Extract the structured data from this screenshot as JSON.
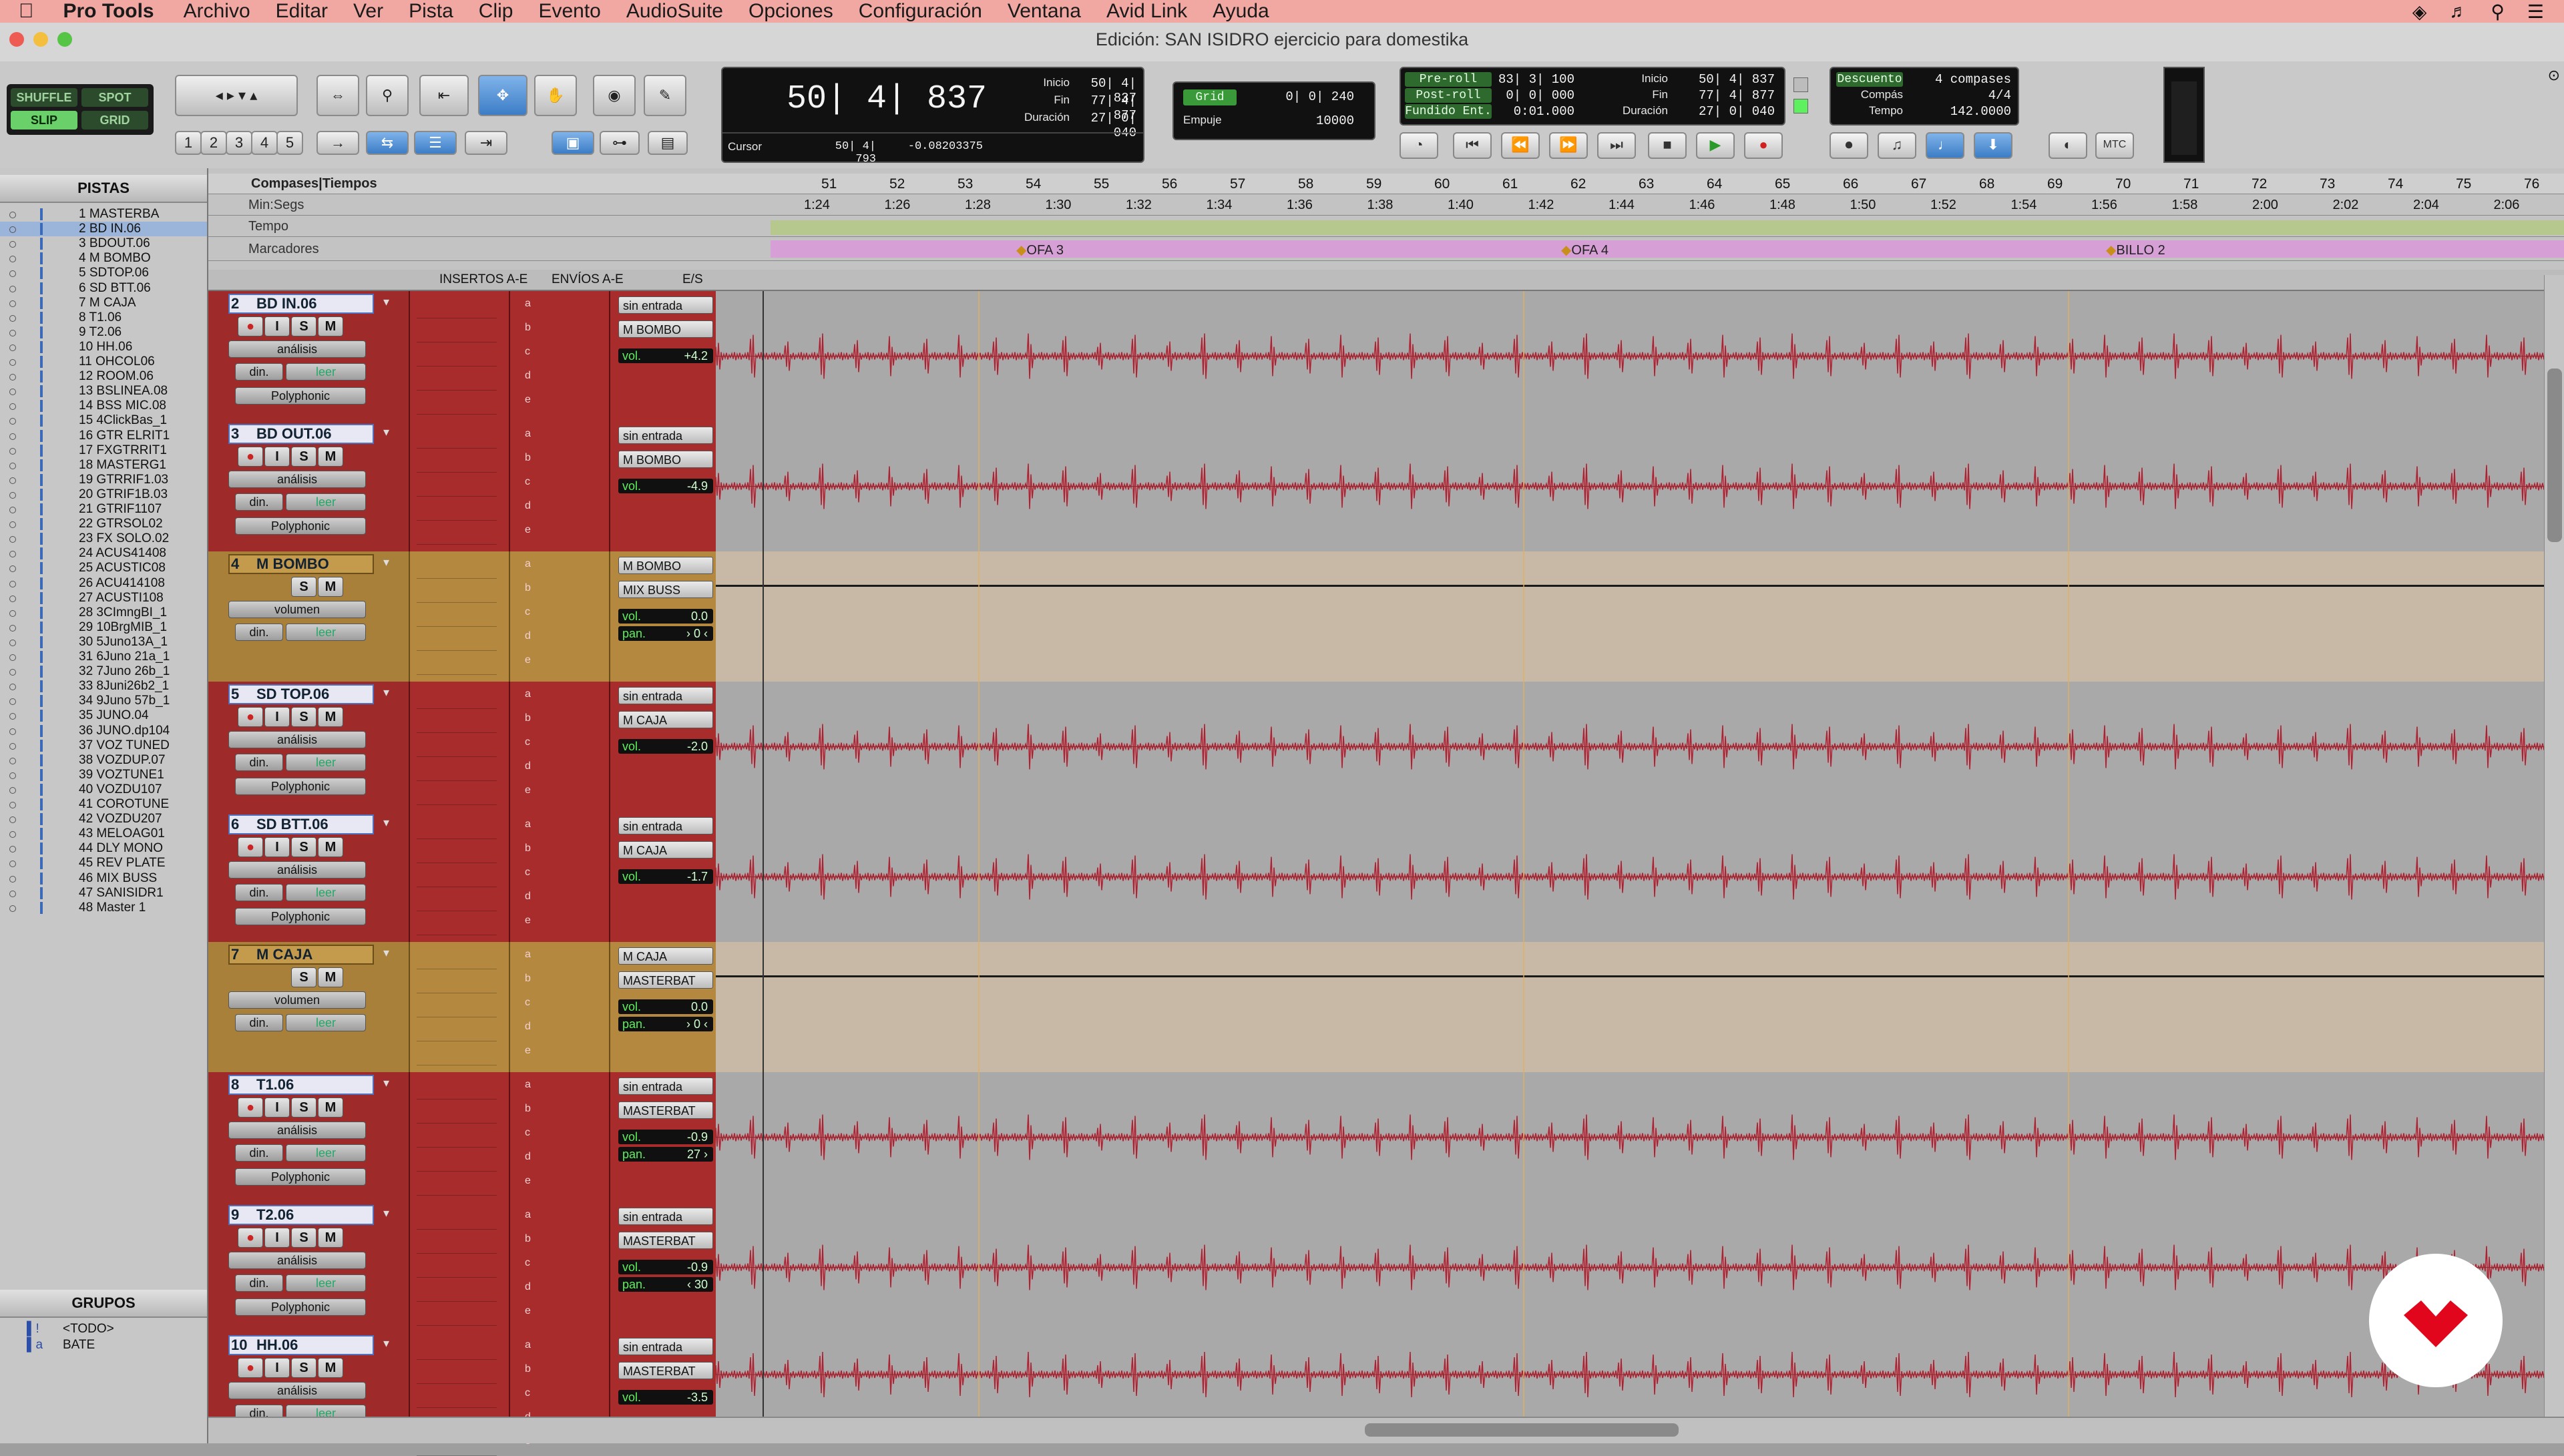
{
  "menubar": {
    "app": "Pro Tools",
    "items": [
      "Archivo",
      "Editar",
      "Ver",
      "Pista",
      "Clip",
      "Evento",
      "AudioSuite",
      "Opciones",
      "Configuración",
      "Ventana",
      "Avid Link",
      "Ayuda"
    ]
  },
  "window": {
    "title": "Edición: SAN ISIDRO ejercicio para domestika"
  },
  "modes": {
    "shuffle": "SHUFFLE",
    "spot": "SPOT",
    "slip": "SLIP",
    "grid": "GRID"
  },
  "zoom_presets": [
    "1",
    "2",
    "3",
    "4",
    "5"
  ],
  "counter": {
    "main": "50| 4| 837",
    "inicio_label": "Inicio",
    "fin_label": "Fin",
    "duracion_label": "Duración",
    "inicio": "50| 4| 837",
    "fin": "77| 4| 877",
    "duracion": "27| 0| 040",
    "cursor_label": "Cursor",
    "cursor": "50| 4| 793",
    "cursor_sample": "-0.08203375"
  },
  "grid": {
    "label": "Grid",
    "value": "0| 0| 240",
    "empuje_label": "Empuje",
    "empuje": "10000"
  },
  "prepost": {
    "preroll_label": "Pre-roll",
    "preroll": "83| 3| 100",
    "postroll_label": "Post-roll",
    "postroll": "0| 0| 000",
    "fundido_label": "Fundido Ent.",
    "fundido": "0:01.000",
    "inicio_label": "Inicio",
    "inicio": "50| 4| 837",
    "fin_label": "Fin",
    "fin": "77| 4| 877",
    "duracion_label": "Duración",
    "duracion": "27| 0| 040"
  },
  "meter": {
    "descuento_label": "Descuento",
    "descuento": "4 compases",
    "compas_label": "Compás",
    "compas": "4/4",
    "tempo_label": "Tempo",
    "tempo": "142.0000"
  },
  "mtc": "MTC",
  "pistas": {
    "header": "PISTAS",
    "items": [
      "1 MASTERBA",
      "2 BD IN.06",
      "3 BDOUT.06",
      "4 M BOMBO",
      "5 SDTOP.06",
      "6 SD BTT.06",
      "7 M CAJA",
      "8 T1.06",
      "9 T2.06",
      "10 HH.06",
      "11 OHCOL06",
      "12 ROOM.06",
      "13 BSLINEA.08",
      "14 BSS MIC.08",
      "15 4ClickBas_1",
      "16 GTR ELRIT1",
      "17 FXGTRRIT1",
      "18 MASTERG1",
      "19 GTRRIF1.03",
      "20 GTRIF1B.03",
      "21 GTRIF1107",
      "22 GTRSOL02",
      "23 FX SOLO.02",
      "24 ACUS41408",
      "25 ACUSTIC08",
      "26 ACU414108",
      "27 ACUSTI108",
      "28 3CImngBI_1",
      "29 10BrgMIB_1",
      "30 5Juno13A_1",
      "31 6Juno 21a_1",
      "32 7Juno 26b_1",
      "33 8Juni26b2_1",
      "34 9Juno 57b_1",
      "35 JUNO.04",
      "36 JUNO.dp104",
      "37 VOZ TUNED",
      "38 VOZDUP.07",
      "39 VOZTUNE1",
      "40 VOZDU107",
      "41 COROTUNE",
      "42 VOZDU207",
      "43 MELOAG01",
      "44 DLY MONO",
      "45 REV PLATE",
      "46 MIX BUSS",
      "47 SANISIDR1",
      "48 Master 1"
    ]
  },
  "grupos": {
    "header": "GRUPOS",
    "items": [
      "<TODO>",
      "BATE"
    ]
  },
  "rulers": {
    "compases": "Compases|Tiempos",
    "minsegs": "Min:Segs",
    "tempo": "Tempo",
    "marcadores": "Marcadores",
    "bars": [
      "51",
      "52",
      "53",
      "54",
      "55",
      "56",
      "57",
      "58",
      "59",
      "60",
      "61",
      "62",
      "63",
      "64",
      "65",
      "66",
      "67",
      "68",
      "69",
      "70",
      "71",
      "72",
      "73",
      "74",
      "75",
      "76"
    ],
    "times": [
      "1:24",
      "1:26",
      "1:28",
      "1:30",
      "1:32",
      "1:34",
      "1:36",
      "1:38",
      "1:40",
      "1:42",
      "1:44",
      "1:46",
      "1:48",
      "1:50",
      "1:52",
      "1:54",
      "1:56",
      "1:58",
      "2:00",
      "2:02",
      "2:04",
      "2:06"
    ],
    "markers": [
      "OFA 3",
      "OFA 4",
      "BILLO 2"
    ]
  },
  "columns": {
    "inserts": "INSERTOS A-E",
    "sends": "ENVÍOS A-E",
    "io": "E/S"
  },
  "tracks": [
    {
      "num": "2",
      "name": "BD IN.06",
      "aux": false,
      "mode": "análisis",
      "din": "din.",
      "leer": "leer",
      "poly": "Polyphonic",
      "input": "sin entrada",
      "output": "M BOMBO",
      "vol": "+4.2",
      "pan": ""
    },
    {
      "num": "3",
      "name": "BD OUT.06",
      "aux": false,
      "mode": "análisis",
      "din": "din.",
      "leer": "leer",
      "poly": "Polyphonic",
      "input": "sin entrada",
      "output": "M BOMBO",
      "vol": "-4.9",
      "pan": ""
    },
    {
      "num": "4",
      "name": "M BOMBO",
      "aux": true,
      "mode": "volumen",
      "din": "din.",
      "leer": "leer",
      "poly": "",
      "input": "M BOMBO",
      "output": "MIX BUSS",
      "vol": "0.0",
      "pan": "› 0 ‹"
    },
    {
      "num": "5",
      "name": "SD TOP.06",
      "aux": false,
      "mode": "análisis",
      "din": "din.",
      "leer": "leer",
      "poly": "Polyphonic",
      "input": "sin entrada",
      "output": "M CAJA",
      "vol": "-2.0",
      "pan": ""
    },
    {
      "num": "6",
      "name": "SD BTT.06",
      "aux": false,
      "mode": "análisis",
      "din": "din.",
      "leer": "leer",
      "poly": "Polyphonic",
      "input": "sin entrada",
      "output": "M CAJA",
      "vol": "-1.7",
      "pan": ""
    },
    {
      "num": "7",
      "name": "M CAJA",
      "aux": true,
      "mode": "volumen",
      "din": "din.",
      "leer": "leer",
      "poly": "",
      "input": "M CAJA",
      "output": "MASTERBAT",
      "vol": "0.0",
      "pan": "› 0 ‹"
    },
    {
      "num": "8",
      "name": "T1.06",
      "aux": false,
      "mode": "análisis",
      "din": "din.",
      "leer": "leer",
      "poly": "Polyphonic",
      "input": "sin entrada",
      "output": "MASTERBAT",
      "vol": "-0.9",
      "pan": "27 ›"
    },
    {
      "num": "9",
      "name": "T2.06",
      "aux": false,
      "mode": "análisis",
      "din": "din.",
      "leer": "leer",
      "poly": "Polyphonic",
      "input": "sin entrada",
      "output": "MASTERBAT",
      "vol": "-0.9",
      "pan": "‹ 30"
    },
    {
      "num": "10",
      "name": "HH.06",
      "aux": false,
      "mode": "análisis",
      "din": "din.",
      "leer": "leer",
      "poly": "",
      "input": "sin entrada",
      "output": "MASTERBAT",
      "vol": "-3.5",
      "pan": ""
    }
  ],
  "labels": {
    "vol": "vol.",
    "pan": "pan.",
    "slots": [
      "a",
      "b",
      "c",
      "d",
      "e"
    ]
  },
  "colors": {
    "audio_track": "#9e2a2a",
    "aux_track": "#b4893f",
    "waveform": "#b02030",
    "marker_ruler": "#d6a0d6",
    "selection": "#9bb4d9"
  }
}
